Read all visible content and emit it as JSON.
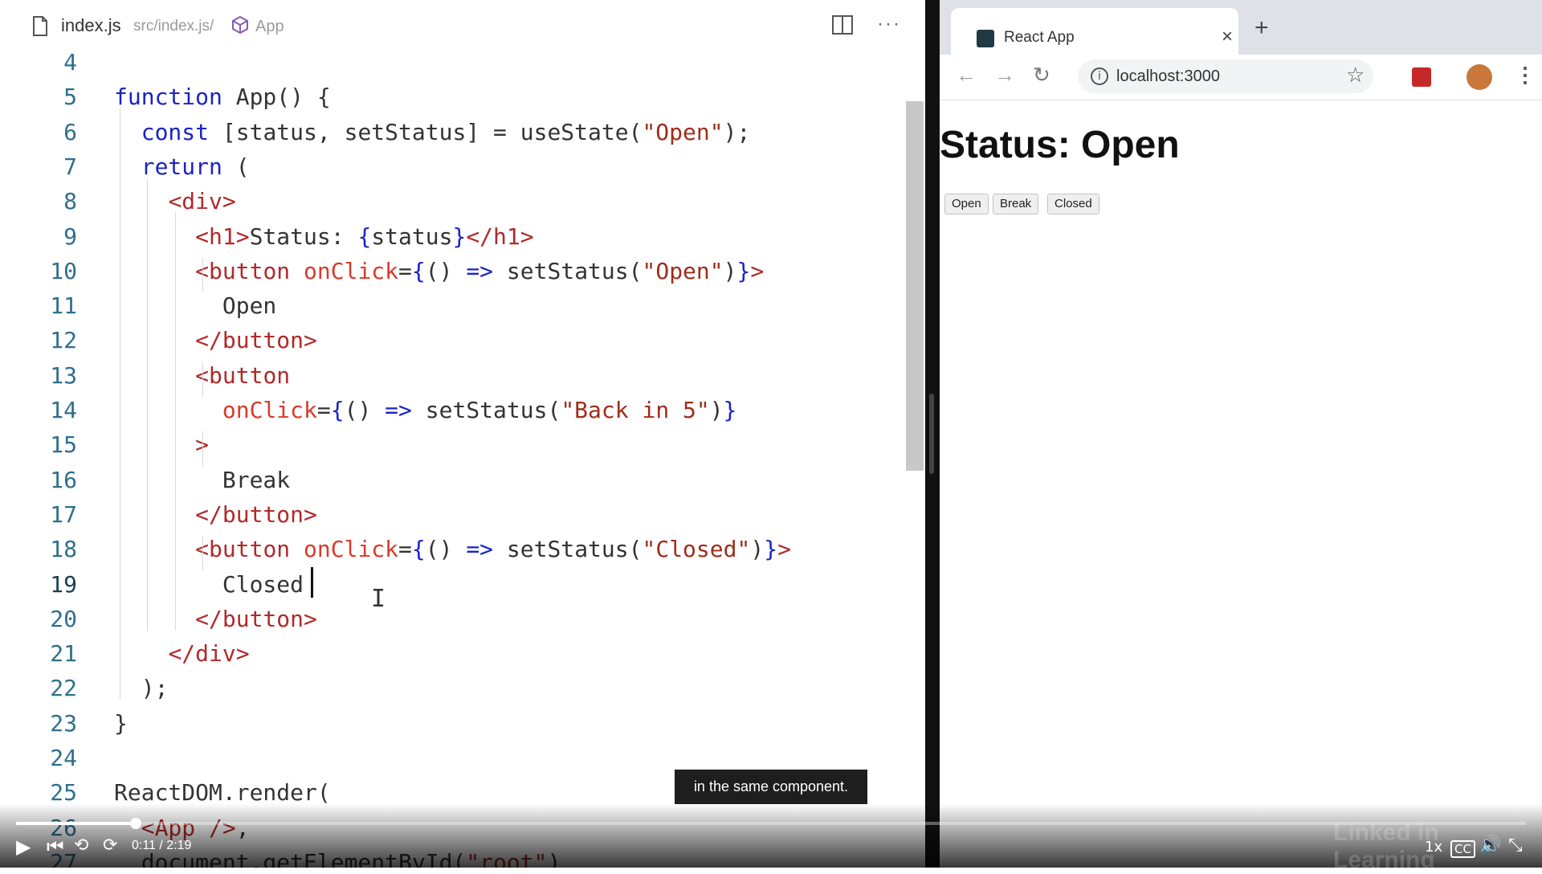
{
  "editor": {
    "filename": "index.js",
    "path": "src/index.js/",
    "symbol": "App",
    "lines": [
      {
        "n": "4",
        "tokens": []
      },
      {
        "n": "5",
        "tokens": [
          {
            "t": "function",
            "c": "kw"
          },
          {
            "t": " App() {",
            "c": ""
          }
        ]
      },
      {
        "n": "6",
        "tokens": [
          {
            "t": "  ",
            "c": ""
          },
          {
            "t": "const",
            "c": "kw"
          },
          {
            "t": " [status, setStatus] = useState(",
            "c": ""
          },
          {
            "t": "\"Open\"",
            "c": "str"
          },
          {
            "t": ");",
            "c": ""
          }
        ]
      },
      {
        "n": "7",
        "tokens": [
          {
            "t": "  ",
            "c": ""
          },
          {
            "t": "return",
            "c": "kw"
          },
          {
            "t": " (",
            "c": ""
          }
        ]
      },
      {
        "n": "8",
        "tokens": [
          {
            "t": "    ",
            "c": ""
          },
          {
            "t": "<div>",
            "c": "tag"
          }
        ]
      },
      {
        "n": "9",
        "tokens": [
          {
            "t": "      ",
            "c": ""
          },
          {
            "t": "<h1>",
            "c": "tag"
          },
          {
            "t": "Status: ",
            "c": ""
          },
          {
            "t": "{",
            "c": "pun"
          },
          {
            "t": "status",
            "c": ""
          },
          {
            "t": "}",
            "c": "pun"
          },
          {
            "t": "</h1>",
            "c": "tag"
          }
        ]
      },
      {
        "n": "10",
        "tokens": [
          {
            "t": "      ",
            "c": ""
          },
          {
            "t": "<button ",
            "c": "tag"
          },
          {
            "t": "onClick",
            "c": "attr"
          },
          {
            "t": "=",
            "c": ""
          },
          {
            "t": "{",
            "c": "pun"
          },
          {
            "t": "() ",
            "c": ""
          },
          {
            "t": "=>",
            "c": "kw"
          },
          {
            "t": " setStatus(",
            "c": ""
          },
          {
            "t": "\"Open\"",
            "c": "str"
          },
          {
            "t": ")",
            "c": ""
          },
          {
            "t": "}",
            "c": "pun"
          },
          {
            "t": ">",
            "c": "tag"
          }
        ]
      },
      {
        "n": "11",
        "tokens": [
          {
            "t": "        Open",
            "c": ""
          }
        ]
      },
      {
        "n": "12",
        "tokens": [
          {
            "t": "      ",
            "c": ""
          },
          {
            "t": "</button>",
            "c": "tag"
          }
        ]
      },
      {
        "n": "13",
        "tokens": [
          {
            "t": "      ",
            "c": ""
          },
          {
            "t": "<button",
            "c": "tag"
          }
        ]
      },
      {
        "n": "14",
        "tokens": [
          {
            "t": "        ",
            "c": ""
          },
          {
            "t": "onClick",
            "c": "attr"
          },
          {
            "t": "=",
            "c": ""
          },
          {
            "t": "{",
            "c": "pun"
          },
          {
            "t": "() ",
            "c": ""
          },
          {
            "t": "=>",
            "c": "kw"
          },
          {
            "t": " setStatus(",
            "c": ""
          },
          {
            "t": "\"Back in 5\"",
            "c": "str"
          },
          {
            "t": ")",
            "c": ""
          },
          {
            "t": "}",
            "c": "pun"
          }
        ]
      },
      {
        "n": "15",
        "tokens": [
          {
            "t": "      ",
            "c": ""
          },
          {
            "t": ">",
            "c": "tag"
          }
        ]
      },
      {
        "n": "16",
        "tokens": [
          {
            "t": "        Break",
            "c": ""
          }
        ]
      },
      {
        "n": "17",
        "tokens": [
          {
            "t": "      ",
            "c": ""
          },
          {
            "t": "</button>",
            "c": "tag"
          }
        ]
      },
      {
        "n": "18",
        "tokens": [
          {
            "t": "      ",
            "c": ""
          },
          {
            "t": "<button ",
            "c": "tag"
          },
          {
            "t": "onClick",
            "c": "attr"
          },
          {
            "t": "=",
            "c": ""
          },
          {
            "t": "{",
            "c": "pun"
          },
          {
            "t": "() ",
            "c": ""
          },
          {
            "t": "=>",
            "c": "kw"
          },
          {
            "t": " setStatus(",
            "c": ""
          },
          {
            "t": "\"Closed\"",
            "c": "str"
          },
          {
            "t": ")",
            "c": ""
          },
          {
            "t": "}",
            "c": "pun"
          },
          {
            "t": ">",
            "c": "tag"
          }
        ]
      },
      {
        "n": "19",
        "tokens": [
          {
            "t": "        Closed",
            "c": ""
          }
        ]
      },
      {
        "n": "20",
        "tokens": [
          {
            "t": "      ",
            "c": ""
          },
          {
            "t": "</button>",
            "c": "tag"
          }
        ]
      },
      {
        "n": "21",
        "tokens": [
          {
            "t": "    ",
            "c": ""
          },
          {
            "t": "</div>",
            "c": "tag"
          }
        ]
      },
      {
        "n": "22",
        "tokens": [
          {
            "t": "  );",
            "c": ""
          }
        ]
      },
      {
        "n": "23",
        "tokens": [
          {
            "t": "}",
            "c": ""
          }
        ]
      },
      {
        "n": "24",
        "tokens": []
      },
      {
        "n": "25",
        "tokens": [
          {
            "t": "ReactDOM.render(",
            "c": ""
          }
        ]
      },
      {
        "n": "26",
        "tokens": [
          {
            "t": "  ",
            "c": ""
          },
          {
            "t": "<App />",
            "c": "tag"
          },
          {
            "t": ",",
            "c": ""
          }
        ]
      },
      {
        "n": "27",
        "tokens": [
          {
            "t": "  document.getElementById(",
            "c": ""
          },
          {
            "t": "\"root\"",
            "c": "str"
          },
          {
            "t": ")",
            "c": ""
          }
        ]
      }
    ]
  },
  "browser": {
    "tab_title": "React App",
    "url": "localhost:3000",
    "heading": "Status: Open",
    "buttons": [
      "Open",
      "Break",
      "Closed"
    ]
  },
  "player": {
    "caption": "in the same component.",
    "time": "0:11 / 2:19",
    "progress": 0.079,
    "speed": "1x",
    "cc": "CC",
    "watermark": "Linked in Learning"
  },
  "icons": {
    "file": "file-icon",
    "cube": "cube-icon",
    "split": "split-editor-icon",
    "more": "more-icon",
    "back": "back-arrow-icon",
    "forward": "forward-arrow-icon",
    "reload": "reload-icon",
    "info": "info-icon",
    "star": "star-icon",
    "play": "play-icon",
    "volume": "volume-icon",
    "fullscreen": "fullscreen-icon"
  },
  "colors": {
    "keyword": "#1a22c7",
    "tag": "#b02a2a",
    "attribute": "#d93a2b",
    "string": "#9e2d1c",
    "line_number": "#2e6f8e"
  }
}
